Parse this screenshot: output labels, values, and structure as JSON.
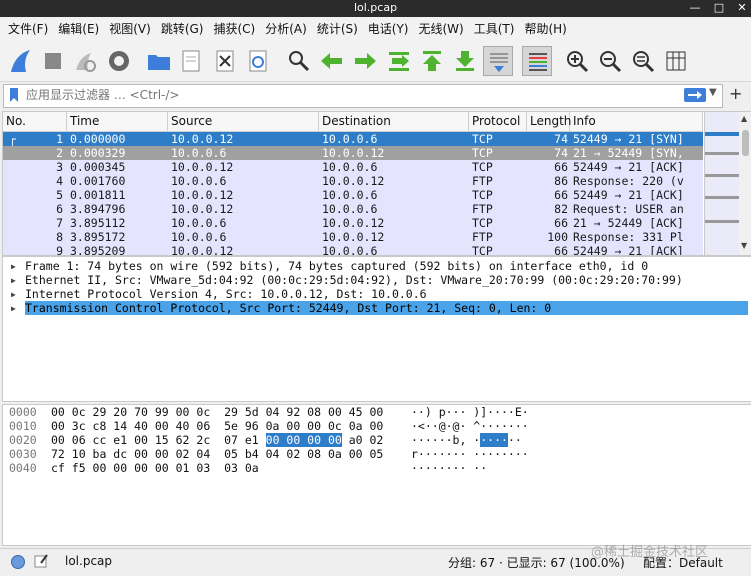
{
  "window": {
    "title": "lol.pcap"
  },
  "menu": [
    "文件(F)",
    "编辑(E)",
    "视图(V)",
    "跳转(G)",
    "捕获(C)",
    "分析(A)",
    "统计(S)",
    "电话(Y)",
    "无线(W)",
    "工具(T)",
    "帮助(H)"
  ],
  "filter": {
    "placeholder": "应用显示过滤器 … <Ctrl-/>"
  },
  "packet_list": {
    "headers": [
      "No.",
      "Time",
      "Source",
      "Destination",
      "Protocol",
      "Length",
      "Info"
    ],
    "rows": [
      {
        "no": "1",
        "time": "0.000000",
        "src": "10.0.0.12",
        "dst": "10.0.0.6",
        "proto": "TCP",
        "len": "74",
        "info": "52449 → 21 [SYN]"
      },
      {
        "no": "2",
        "time": "0.000329",
        "src": "10.0.0.6",
        "dst": "10.0.0.12",
        "proto": "TCP",
        "len": "74",
        "info": "21 → 52449 [SYN,"
      },
      {
        "no": "3",
        "time": "0.000345",
        "src": "10.0.0.12",
        "dst": "10.0.0.6",
        "proto": "TCP",
        "len": "66",
        "info": "52449 → 21 [ACK]"
      },
      {
        "no": "4",
        "time": "0.001760",
        "src": "10.0.0.6",
        "dst": "10.0.0.12",
        "proto": "FTP",
        "len": "86",
        "info": "Response: 220 (v"
      },
      {
        "no": "5",
        "time": "0.001811",
        "src": "10.0.0.12",
        "dst": "10.0.0.6",
        "proto": "TCP",
        "len": "66",
        "info": "52449 → 21 [ACK]"
      },
      {
        "no": "6",
        "time": "3.894796",
        "src": "10.0.0.12",
        "dst": "10.0.0.6",
        "proto": "FTP",
        "len": "82",
        "info": "Request: USER an"
      },
      {
        "no": "7",
        "time": "3.895112",
        "src": "10.0.0.6",
        "dst": "10.0.0.12",
        "proto": "TCP",
        "len": "66",
        "info": "21 → 52449 [ACK]"
      },
      {
        "no": "8",
        "time": "3.895172",
        "src": "10.0.0.6",
        "dst": "10.0.0.12",
        "proto": "FTP",
        "len": "100",
        "info": "Response: 331 Pl"
      },
      {
        "no": "9",
        "time": "3.895209",
        "src": "10.0.0.12",
        "dst": "10.0.0.6",
        "proto": "TCP",
        "len": "66",
        "info": "52449 → 21 [ACK]"
      }
    ]
  },
  "details": [
    "Frame 1: 74 bytes on wire (592 bits), 74 bytes captured (592 bits) on interface eth0, id 0",
    "Ethernet II, Src: VMware_5d:04:92 (00:0c:29:5d:04:92), Dst: VMware_20:70:99 (00:0c:29:20:70:99)",
    "Internet Protocol Version 4, Src: 10.0.0.12, Dst: 10.0.0.6",
    "Transmission Control Protocol, Src Port: 52449, Dst Port: 21, Seq: 0, Len: 0"
  ],
  "hex": [
    {
      "off": "0000",
      "pre": "00 0c 29 20 70 99 00 0c  29 5d 04 92 08 00 45 00",
      "hi": "",
      "post": "",
      "apre": "··) p··· )]····E·",
      "ahi": "",
      "apost": ""
    },
    {
      "off": "0010",
      "pre": "00 3c c8 14 40 00 40 06  5e 96 0a 00 00 0c 0a 00",
      "hi": "",
      "post": "",
      "apre": "·<··@·@· ^·······",
      "ahi": "",
      "apost": ""
    },
    {
      "off": "0020",
      "pre": "00 06 cc e1 00 15 62 2c  07 e1 ",
      "hi": "00 00 00 00",
      "post": " a0 02",
      "apre": "······b, ·",
      "ahi": "····",
      "apost": "··"
    },
    {
      "off": "0030",
      "pre": "72 10 ba dc 00 00 02 04  05 b4 04 02 08 0a 00 05",
      "hi": "",
      "post": "",
      "apre": "r······· ········",
      "ahi": "",
      "apost": ""
    },
    {
      "off": "0040",
      "pre": "cf f5 00 00 00 00 01 03  03 0a",
      "hi": "",
      "post": "",
      "apre": "········ ··",
      "ahi": "",
      "apost": ""
    }
  ],
  "status": {
    "file": "lol.pcap",
    "packets": "分组: 67 · 已显示: 67 (100.0%)",
    "profile": "配置：Default",
    "watermark": "@稀土掘金技术社区"
  },
  "colors": {
    "selected": "#2d7dc9",
    "tcp_row": "#e4e4fe",
    "accent_blue": "#3d7edb",
    "toolbar_green": "#4fb330"
  }
}
